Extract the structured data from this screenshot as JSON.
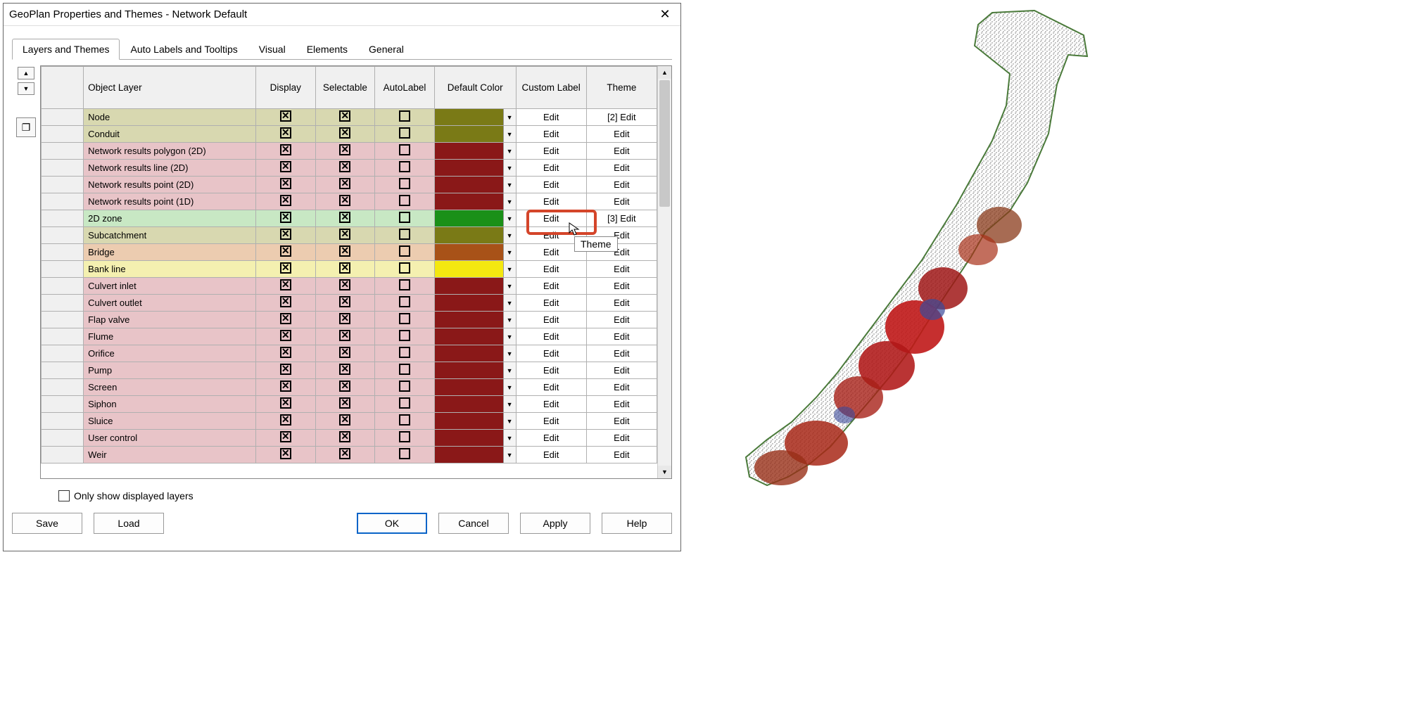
{
  "window": {
    "title": "GeoPlan Properties and Themes - Network Default"
  },
  "tabs": [
    "Layers and Themes",
    "Auto Labels and Tooltips",
    "Visual",
    "Elements",
    "General"
  ],
  "active_tab": 0,
  "columns": {
    "layer": "Object Layer",
    "display": "Display",
    "selectable": "Selectable",
    "autolabel": "AutoLabel",
    "color": "Default Color",
    "custom": "Custom Label",
    "theme": "Theme"
  },
  "rows": [
    {
      "name": "Node",
      "display": true,
      "selectable": true,
      "autolabel": false,
      "color": "#7a7a16",
      "tint": "row-olive",
      "custom": "Edit",
      "theme": "[2] Edit"
    },
    {
      "name": "Conduit",
      "display": true,
      "selectable": true,
      "autolabel": false,
      "color": "#7a7a16",
      "tint": "row-olive",
      "custom": "Edit",
      "theme": "Edit"
    },
    {
      "name": "Network results polygon (2D)",
      "display": true,
      "selectable": true,
      "autolabel": false,
      "color": "#8a1818",
      "tint": "row-pink",
      "custom": "Edit",
      "theme": "Edit"
    },
    {
      "name": "Network results line (2D)",
      "display": true,
      "selectable": true,
      "autolabel": false,
      "color": "#8a1818",
      "tint": "row-pink",
      "custom": "Edit",
      "theme": "Edit"
    },
    {
      "name": "Network results point (2D)",
      "display": true,
      "selectable": true,
      "autolabel": false,
      "color": "#8a1818",
      "tint": "row-pink",
      "custom": "Edit",
      "theme": "Edit"
    },
    {
      "name": "Network results point (1D)",
      "display": true,
      "selectable": true,
      "autolabel": false,
      "color": "#8a1818",
      "tint": "row-pink",
      "custom": "Edit",
      "theme": "Edit"
    },
    {
      "name": "2D zone",
      "display": true,
      "selectable": true,
      "autolabel": false,
      "color": "#1a9018",
      "tint": "row-green",
      "custom": "Edit",
      "theme": "[3] Edit",
      "highlight": true
    },
    {
      "name": "Subcatchment",
      "display": true,
      "selectable": true,
      "autolabel": false,
      "color": "#7a7a16",
      "tint": "row-olive",
      "custom": "Edit",
      "theme": "Edit"
    },
    {
      "name": "Bridge",
      "display": true,
      "selectable": true,
      "autolabel": false,
      "color": "#a85218",
      "tint": "row-orange",
      "custom": "Edit",
      "theme": "Edit"
    },
    {
      "name": "Bank line",
      "display": true,
      "selectable": true,
      "autolabel": false,
      "color": "#f4e810",
      "tint": "row-yellow",
      "custom": "Edit",
      "theme": "Edit"
    },
    {
      "name": "Culvert inlet",
      "display": true,
      "selectable": true,
      "autolabel": false,
      "color": "#8a1818",
      "tint": "row-pink",
      "custom": "Edit",
      "theme": "Edit"
    },
    {
      "name": "Culvert outlet",
      "display": true,
      "selectable": true,
      "autolabel": false,
      "color": "#8a1818",
      "tint": "row-pink",
      "custom": "Edit",
      "theme": "Edit"
    },
    {
      "name": "Flap valve",
      "display": true,
      "selectable": true,
      "autolabel": false,
      "color": "#8a1818",
      "tint": "row-pink",
      "custom": "Edit",
      "theme": "Edit"
    },
    {
      "name": "Flume",
      "display": true,
      "selectable": true,
      "autolabel": false,
      "color": "#8a1818",
      "tint": "row-pink",
      "custom": "Edit",
      "theme": "Edit"
    },
    {
      "name": "Orifice",
      "display": true,
      "selectable": true,
      "autolabel": false,
      "color": "#8a1818",
      "tint": "row-pink",
      "custom": "Edit",
      "theme": "Edit"
    },
    {
      "name": "Pump",
      "display": true,
      "selectable": true,
      "autolabel": false,
      "color": "#8a1818",
      "tint": "row-pink",
      "custom": "Edit",
      "theme": "Edit"
    },
    {
      "name": "Screen",
      "display": true,
      "selectable": true,
      "autolabel": false,
      "color": "#8a1818",
      "tint": "row-pink",
      "custom": "Edit",
      "theme": "Edit"
    },
    {
      "name": "Siphon",
      "display": true,
      "selectable": true,
      "autolabel": false,
      "color": "#8a1818",
      "tint": "row-pink",
      "custom": "Edit",
      "theme": "Edit"
    },
    {
      "name": "Sluice",
      "display": true,
      "selectable": true,
      "autolabel": false,
      "color": "#8a1818",
      "tint": "row-pink",
      "custom": "Edit",
      "theme": "Edit"
    },
    {
      "name": "User control",
      "display": true,
      "selectable": true,
      "autolabel": false,
      "color": "#8a1818",
      "tint": "row-pink",
      "custom": "Edit",
      "theme": "Edit"
    },
    {
      "name": "Weir",
      "display": true,
      "selectable": true,
      "autolabel": false,
      "color": "#8a1818",
      "tint": "row-pink",
      "custom": "Edit",
      "theme": "Edit"
    }
  ],
  "tooltip": "Theme",
  "footer": {
    "only_displayed": "Only show displayed layers"
  },
  "buttons": {
    "save": "Save",
    "load": "Load",
    "ok": "OK",
    "cancel": "Cancel",
    "apply": "Apply",
    "help": "Help"
  }
}
